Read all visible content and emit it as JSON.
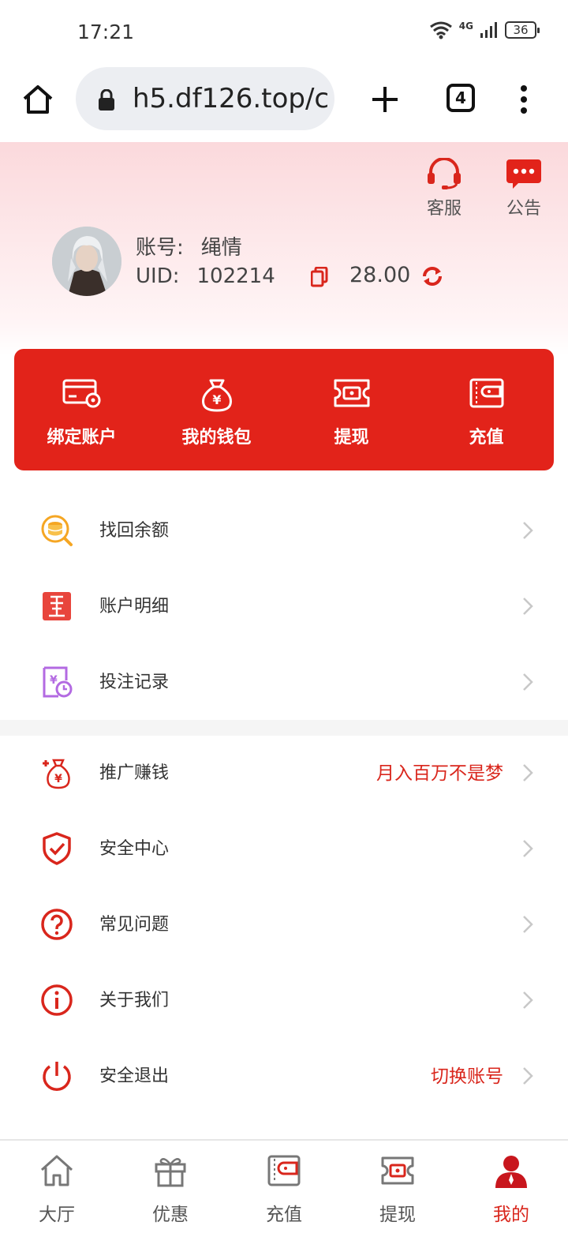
{
  "status_bar": {
    "time": "17:21",
    "network": "4G",
    "battery": "36"
  },
  "browser": {
    "url": "h5.df126.top/c",
    "tab_count": "4"
  },
  "header": {
    "service_label": "客服",
    "notice_label": "公告",
    "account_label": "账号:",
    "account_value": "绳情",
    "uid_label": "UID:",
    "uid_value": "102214",
    "balance": "28.00"
  },
  "quick_actions": [
    {
      "label": "绑定账户",
      "icon": "card-settings-icon"
    },
    {
      "label": "我的钱包",
      "icon": "money-bag-icon"
    },
    {
      "label": "提现",
      "icon": "withdraw-icon"
    },
    {
      "label": "充值",
      "icon": "wallet-icon"
    }
  ],
  "menu_group_1": [
    {
      "label": "找回余额",
      "icon": "coin-search-icon"
    },
    {
      "label": "账户明细",
      "icon": "ledger-icon"
    },
    {
      "label": "投注记录",
      "icon": "bet-record-icon"
    }
  ],
  "menu_group_2": [
    {
      "label": "推广赚钱",
      "extra": "月入百万不是梦",
      "icon": "promo-bag-icon"
    },
    {
      "label": "安全中心",
      "extra": "",
      "icon": "shield-icon"
    },
    {
      "label": "常见问题",
      "extra": "",
      "icon": "question-icon"
    },
    {
      "label": "关于我们",
      "extra": "",
      "icon": "info-icon"
    },
    {
      "label": "安全退出",
      "extra": "切换账号",
      "icon": "power-icon"
    }
  ],
  "bottom_nav": [
    {
      "label": "大厅",
      "icon": "home-icon"
    },
    {
      "label": "优惠",
      "icon": "gift-icon"
    },
    {
      "label": "充值",
      "icon": "wallet-icon"
    },
    {
      "label": "提现",
      "icon": "withdraw-icon"
    },
    {
      "label": "我的",
      "icon": "user-icon",
      "active": true
    }
  ],
  "colors": {
    "accent": "#e2231a",
    "text_red": "#d9261c",
    "header_pink": "#fbd9dc"
  }
}
